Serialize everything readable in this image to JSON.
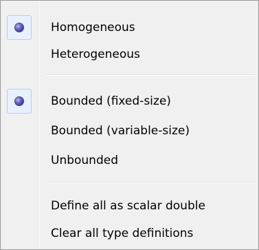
{
  "menu": {
    "items": [
      {
        "label": "Homogeneous",
        "selected": true
      },
      {
        "label": "Heterogeneous",
        "selected": false
      },
      {
        "label": "Bounded (fixed-size)",
        "selected": true
      },
      {
        "label": "Bounded (variable-size)",
        "selected": false
      },
      {
        "label": "Unbounded",
        "selected": false
      },
      {
        "label": "Define all as scalar double",
        "selected": false
      },
      {
        "label": "Clear all type definitions",
        "selected": false
      }
    ]
  },
  "icons": {
    "selected_indicator": "radio-dot-icon"
  },
  "colors": {
    "menu_background": "#f0f0f0",
    "menu_border": "#979797",
    "check_highlight": "#e8f1fb",
    "check_border": "#aecff7",
    "radio_dot": "#3a3a82"
  }
}
